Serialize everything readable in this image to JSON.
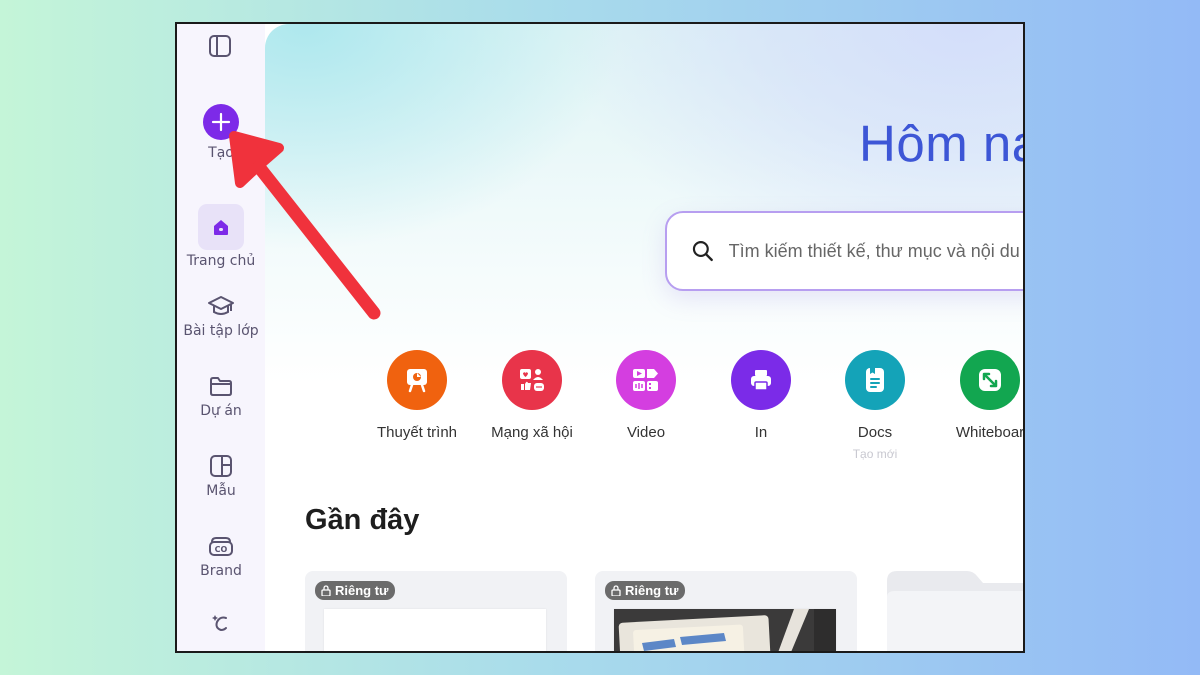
{
  "sidebar": {
    "toggle_icon": "sidebar-toggle-icon",
    "create_label": "Tạo",
    "items": [
      {
        "label": "Trang chủ",
        "icon": "home-icon",
        "active": true
      },
      {
        "label": "Bài tập lớp",
        "icon": "graduation-cap-icon"
      },
      {
        "label": "Dự án",
        "icon": "folder-icon"
      },
      {
        "label": "Mẫu",
        "icon": "template-icon"
      },
      {
        "label": "Brand",
        "icon": "brand-icon"
      },
      {
        "label": "",
        "icon": "magic-icon"
      }
    ]
  },
  "hero": {
    "title": "Hôm na",
    "search_placeholder": "Tìm kiếm thiết kế, thư mục và nội du"
  },
  "quick_actions": [
    {
      "label": "Thuyết trình",
      "color": "#f0620f",
      "icon": "presentation-icon"
    },
    {
      "label": "Mạng xã hội",
      "color": "#e8344a",
      "icon": "social-media-icon"
    },
    {
      "label": "Video",
      "color": "#d43ee0",
      "icon": "video-icon"
    },
    {
      "label": "In",
      "color": "#7b2be8",
      "icon": "printer-icon"
    },
    {
      "label": "Docs",
      "sub": "Tạo mới",
      "color": "#14a3b8",
      "icon": "docs-icon"
    },
    {
      "label": "Whiteboar",
      "color": "#12a650",
      "icon": "whiteboard-icon"
    }
  ],
  "recent": {
    "title": "Gần đây",
    "cards": [
      {
        "badge": "Riêng tư"
      },
      {
        "badge": "Riêng tư"
      }
    ]
  },
  "colors": {
    "brand_purple": "#7d2ae8",
    "annotation_red": "#f0323c"
  }
}
